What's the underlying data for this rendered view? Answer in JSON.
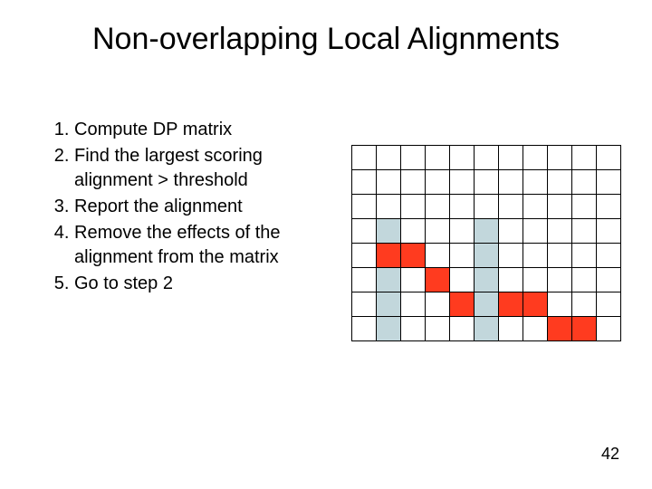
{
  "title": "Non-overlapping Local Alignments",
  "steps": [
    "Compute DP matrix",
    "Find the largest scoring alignment > threshold",
    "Report the alignment",
    "Remove the effects of the alignment from the matrix",
    "Go to step 2"
  ],
  "page_number": "42",
  "grid": {
    "rows": 8,
    "cols": 11,
    "colors": {
      "blue": "#c2d7dc",
      "red": "#ff3b1f"
    },
    "cells": [
      [
        4,
        2,
        "blue"
      ],
      [
        4,
        6,
        "blue"
      ],
      [
        5,
        2,
        "red"
      ],
      [
        5,
        3,
        "red"
      ],
      [
        5,
        6,
        "blue"
      ],
      [
        6,
        2,
        "blue"
      ],
      [
        6,
        4,
        "red"
      ],
      [
        6,
        6,
        "blue"
      ],
      [
        7,
        2,
        "blue"
      ],
      [
        7,
        5,
        "red"
      ],
      [
        7,
        6,
        "blue"
      ],
      [
        7,
        7,
        "red"
      ],
      [
        7,
        8,
        "red"
      ],
      [
        8,
        2,
        "blue"
      ],
      [
        8,
        6,
        "blue"
      ],
      [
        8,
        9,
        "red"
      ],
      [
        8,
        10,
        "red"
      ]
    ]
  }
}
